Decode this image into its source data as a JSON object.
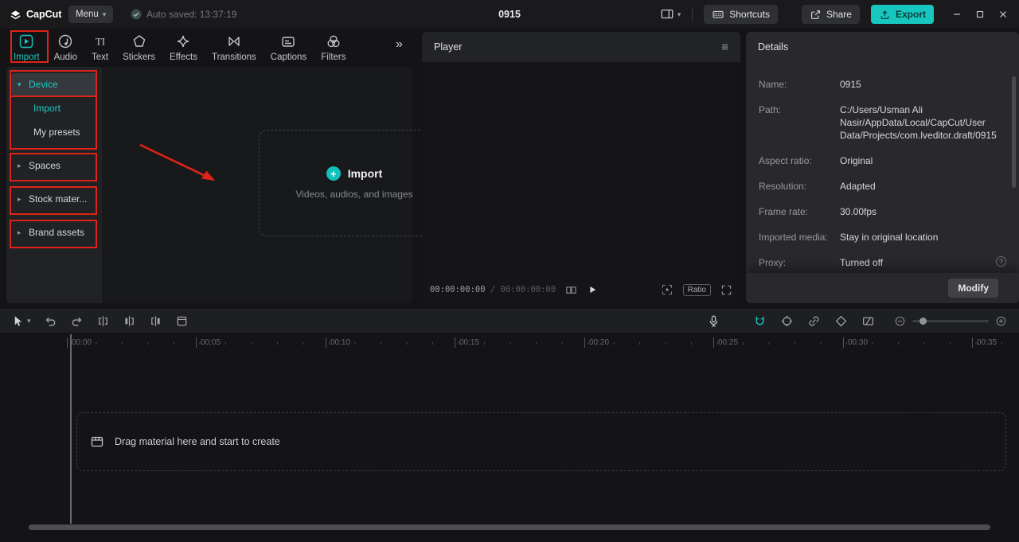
{
  "colors": {
    "accent": "#17c6bf",
    "annotation": "#e02318"
  },
  "icons": {
    "caret_down": "▾",
    "caret_right": "▸",
    "more": "»",
    "hamburger": "≡",
    "plus": "+",
    "question": "?"
  },
  "titlebar": {
    "logo": "CapCut",
    "menu": "Menu",
    "autosave": "Auto saved: 13:37:19",
    "title": "0915",
    "shortcuts": "Shortcuts",
    "share": "Share",
    "export": "Export"
  },
  "toolbar": {
    "items": [
      {
        "label": "Import"
      },
      {
        "label": "Audio"
      },
      {
        "label": "Text"
      },
      {
        "label": "Stickers"
      },
      {
        "label": "Effects"
      },
      {
        "label": "Transitions"
      },
      {
        "label": "Captions"
      },
      {
        "label": "Filters"
      }
    ]
  },
  "sidebar": {
    "items": [
      {
        "label": "Device"
      },
      {
        "label": "Import"
      },
      {
        "label": "My presets"
      },
      {
        "label": "Spaces"
      },
      {
        "label": "Stock mater..."
      },
      {
        "label": "Brand assets"
      }
    ]
  },
  "import_area": {
    "title": "Import",
    "subtitle": "Videos, audios, and images"
  },
  "player": {
    "title": "Player",
    "current": "00:00:00:00",
    "separator": " / ",
    "total": "00:00:00:00",
    "ratio": "Ratio"
  },
  "details": {
    "title": "Details",
    "rows": [
      {
        "label": "Name:",
        "value": "0915"
      },
      {
        "label": "Path:",
        "value": "C:/Users/Usman Ali Nasir/AppData/Local/CapCut/User Data/Projects/com.lveditor.draft/0915"
      },
      {
        "label": "Aspect ratio:",
        "value": "Original"
      },
      {
        "label": "Resolution:",
        "value": "Adapted"
      },
      {
        "label": "Frame rate:",
        "value": "30.00fps"
      },
      {
        "label": "Imported media:",
        "value": "Stay in original location"
      },
      {
        "label": "Proxy:",
        "value": "Turned off"
      }
    ],
    "modify": "Modify"
  },
  "timeline": {
    "ruler": [
      "00:00",
      "00:05",
      "00:10",
      "00:15",
      "00:20",
      "00:25",
      "00:30",
      "00:35"
    ],
    "drop_hint": "Drag material here and start to create"
  }
}
